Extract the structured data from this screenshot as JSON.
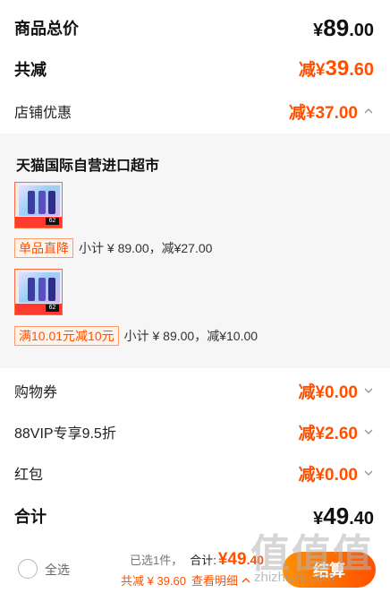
{
  "summary": {
    "total_label": "商品总价",
    "total_yen": "¥",
    "total_int": "89",
    "total_dec": ".00",
    "discount_label": "共减",
    "discount_prefix": "减¥",
    "discount_int": "39",
    "discount_dec": ".60",
    "store_discount_label": "店铺优惠",
    "store_discount_value": "减¥37.00"
  },
  "store": {
    "name": "天猫国际自营进口超市",
    "items": [
      {
        "thumb_badge": "62",
        "promo_tag": "单品直降",
        "promo_text": "小计 ¥ 89.00，减¥27.00"
      },
      {
        "thumb_badge": "62",
        "promo_tag": "满10.01元减10元",
        "promo_text": "小计 ¥ 89.00，减¥10.00"
      }
    ]
  },
  "deductions": [
    {
      "label": "购物券",
      "value": "减¥0.00"
    },
    {
      "label": "88VIP专享9.5折",
      "value": "减¥2.60"
    },
    {
      "label": "红包",
      "value": "减¥0.00"
    }
  ],
  "grand_total": {
    "label": "合计",
    "yen": "¥",
    "int": "49",
    "dec": ".40"
  },
  "footer": {
    "select_all": "全选",
    "selected_count": "已选1件，",
    "total_label": "合计:",
    "amount_int": "¥49",
    "amount_dec": ".40",
    "saved_text": "共减 ¥ 39.60",
    "detail_link": "查看明细",
    "checkout": "结算"
  },
  "watermark": {
    "main": "值值值",
    "sub": "zhizhizhi.com"
  },
  "colors": {
    "accent": "#ff5000",
    "panel_bg": "#f6f6f6"
  }
}
